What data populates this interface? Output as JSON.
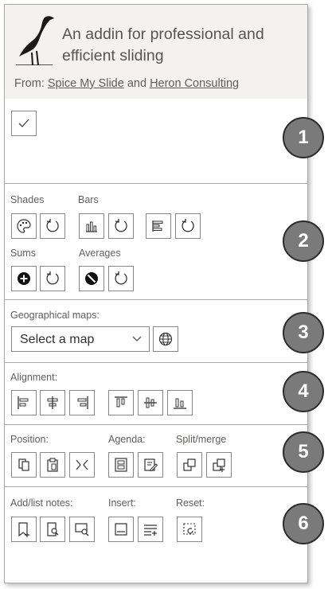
{
  "header": {
    "tagline": "An addin for professional and efficient sliding",
    "from_label": "From:",
    "link1": "Spice My Slide",
    "and_label": "and",
    "link2": "Heron Consulting"
  },
  "section1": {
    "check_icon": "checkmark-icon"
  },
  "section2": {
    "shades_label": "Shades",
    "bars_label": "Bars",
    "sums_label": "Sums",
    "averages_label": "Averages"
  },
  "section3": {
    "maps_label": "Geographical maps:",
    "map_select_value": "Select a map"
  },
  "section4": {
    "alignment_label": "Alignment:"
  },
  "section5": {
    "position_label": "Position:",
    "agenda_label": "Agenda:",
    "split_label": "Split/merge"
  },
  "section6": {
    "notes_label": "Add/list notes:",
    "insert_label": "Insert:",
    "reset_label": "Reset:"
  },
  "callouts": [
    "1",
    "2",
    "3",
    "4",
    "5",
    "6"
  ],
  "colors": {
    "header_bg": "#f3f2f1",
    "callout_bg": "#7a7a7a",
    "border": "#a8a8a8"
  }
}
